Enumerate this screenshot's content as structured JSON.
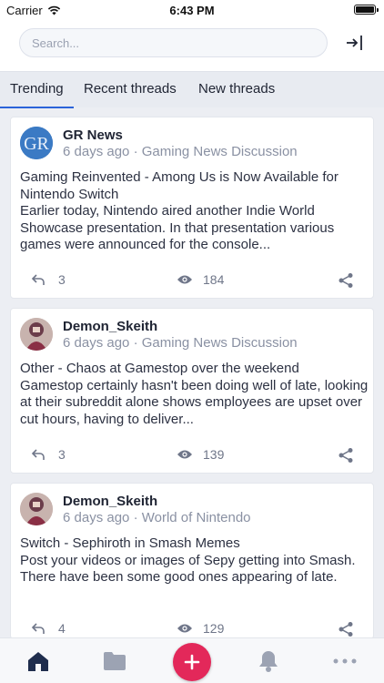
{
  "status_bar": {
    "carrier": "Carrier",
    "time": "6:43 PM"
  },
  "search": {
    "placeholder": "Search..."
  },
  "tabs": [
    {
      "label": "Trending",
      "active": true
    },
    {
      "label": "Recent threads",
      "active": false
    },
    {
      "label": "New threads",
      "active": false
    }
  ],
  "threads": [
    {
      "author": "GR News",
      "time": "6 days ago",
      "separator": "·",
      "forum": "Gaming News Discussion",
      "title": "Gaming Reinvented - Among Us is Now Available for Nintendo Switch",
      "excerpt": "Earlier today, Nintendo aired another Indie World Showcase presentation. In that presentation various games were announced for the console...",
      "replies": "3",
      "views": "184",
      "avatar_text": "GR"
    },
    {
      "author": "Demon_Skeith",
      "time": "6 days ago",
      "separator": "·",
      "forum": "Gaming News Discussion",
      "title": "Other - Chaos at Gamestop over the weekend",
      "excerpt": "Gamestop certainly hasn't been doing well of late, looking at their subreddit alone shows employees are upset over cut hours, having to deliver...",
      "replies": "3",
      "views": "139"
    },
    {
      "author": "Demon_Skeith",
      "time": "6 days ago",
      "separator": "·",
      "forum": "World of Nintendo",
      "title": "Switch - Sephiroth in Smash Memes",
      "excerpt": "Post your videos or images of Sepy getting into Smash. There have been some good ones appearing of late.",
      "replies": "4",
      "views": "129"
    }
  ],
  "bottom_nav": [
    "home-icon",
    "folder-icon",
    "plus-icon",
    "bell-icon",
    "more-icon"
  ],
  "colors": {
    "accent": "#2b63d9",
    "fab": "#e3285a",
    "icon": "#1f2d4d",
    "muted": "#8a91a3"
  }
}
